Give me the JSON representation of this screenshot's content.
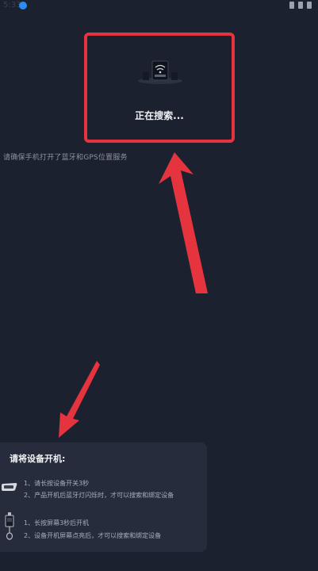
{
  "status_bar": {
    "time": "5:33"
  },
  "search": {
    "status_text": "正在搜索..."
  },
  "hint": {
    "text": "请确保手机打开了蓝牙和GPS位置服务"
  },
  "instructions": {
    "title": "请将设备开机:",
    "group1": {
      "step1": "1、请长按设备开关3秒",
      "step2": "2、产品开机后蓝牙灯闪烁时，才可以搜索和绑定设备"
    },
    "group2": {
      "step1": "1、长按屏幕3秒后开机",
      "step2": "2、设备开机屏幕点亮后，才可以搜索和绑定设备"
    }
  },
  "colors": {
    "background": "#1c2130",
    "highlight_red": "#e6343f",
    "panel": "#262c3b"
  }
}
